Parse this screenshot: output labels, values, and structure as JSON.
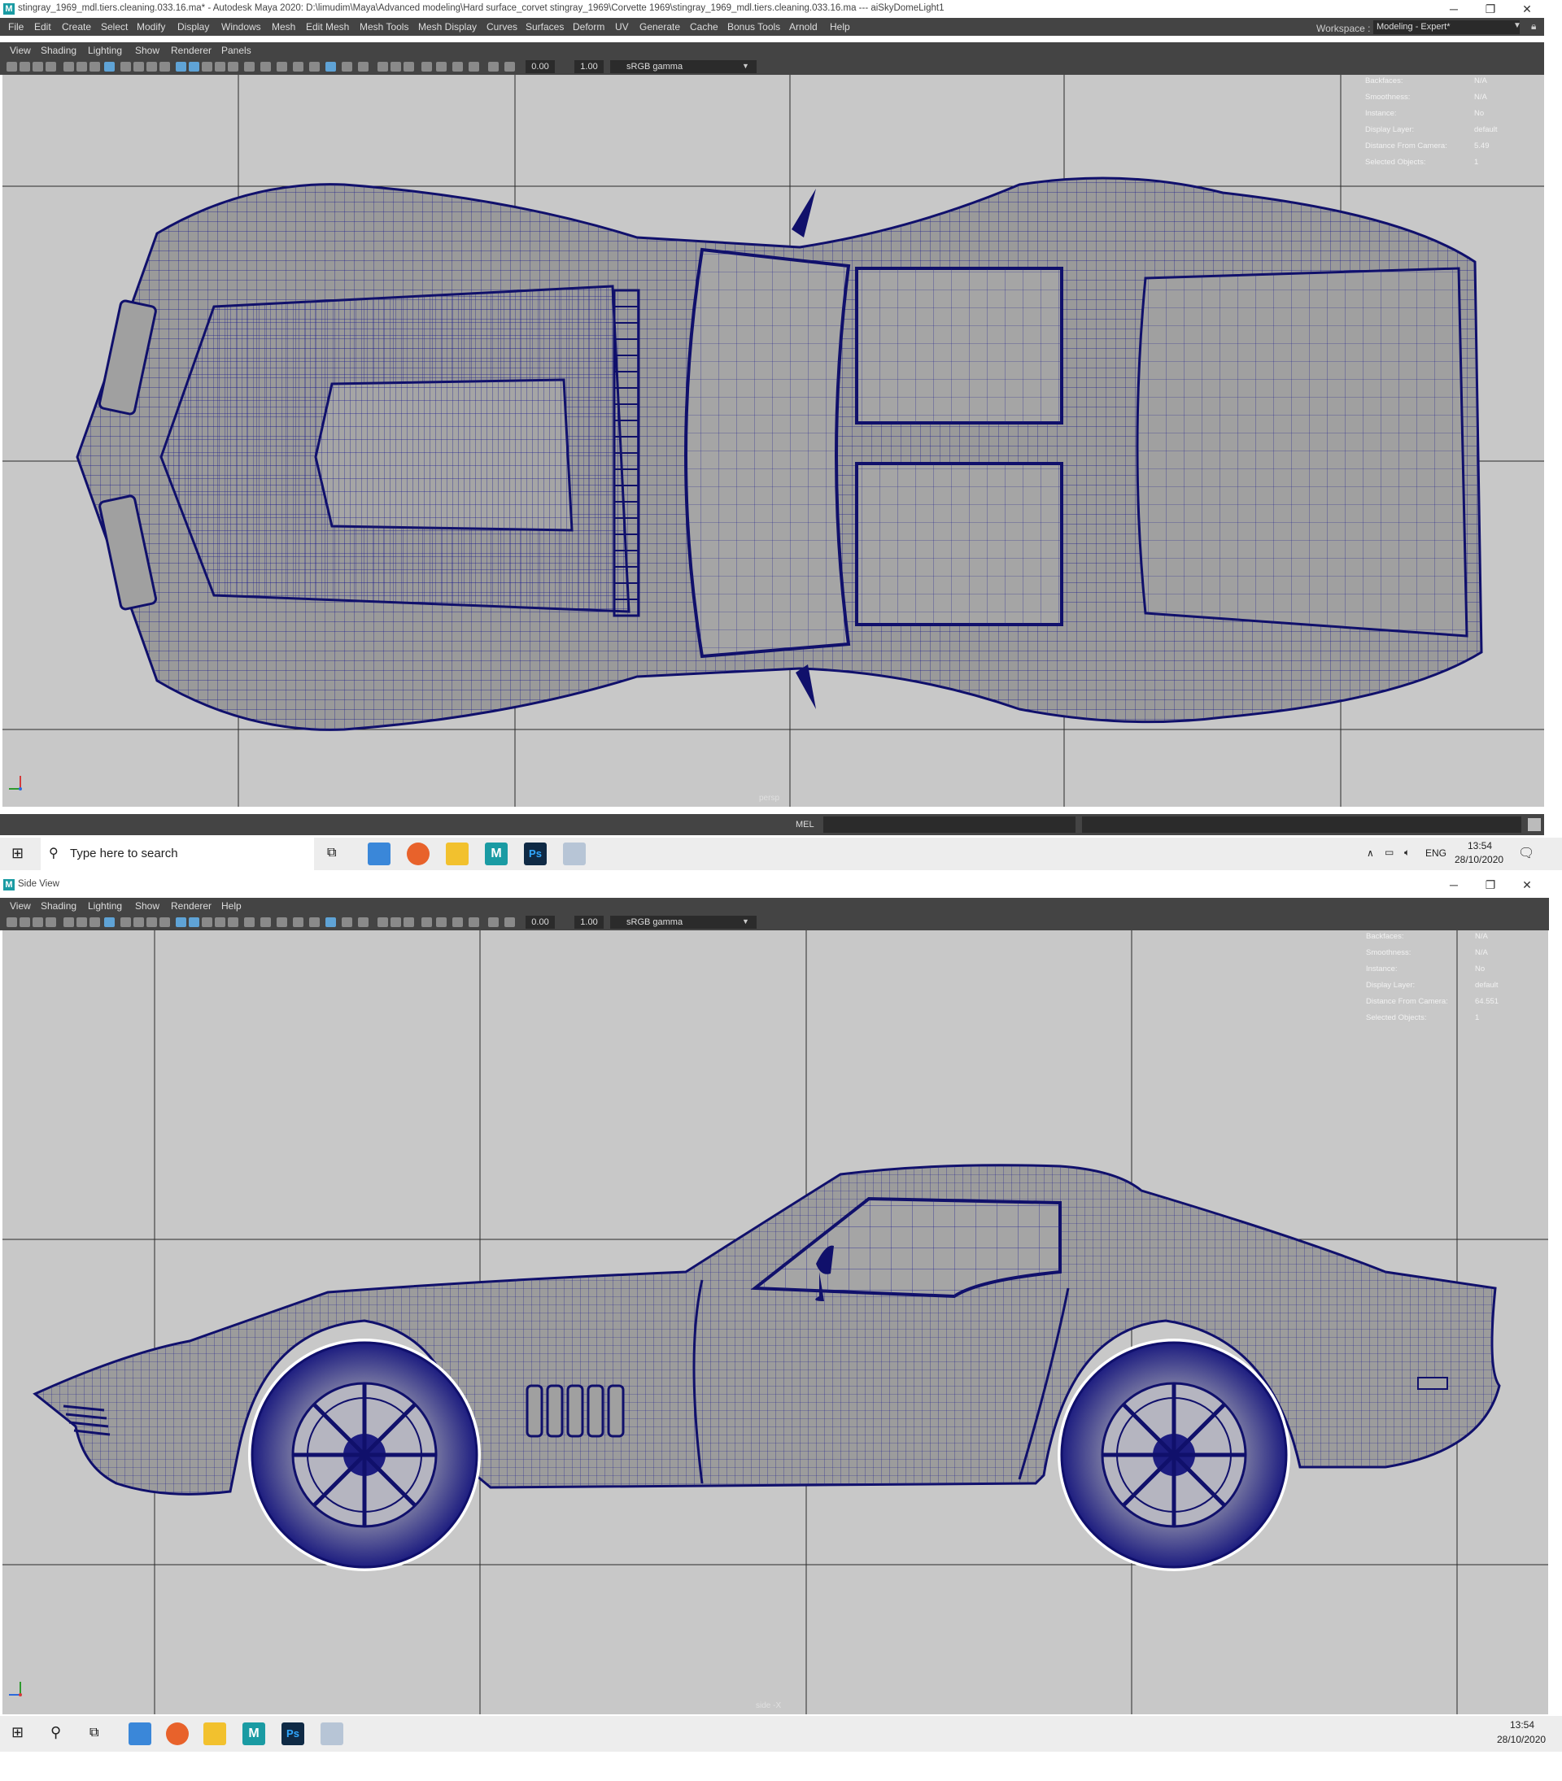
{
  "main_window": {
    "title": "stingray_1969_mdl.tiers.cleaning.033.16.ma* - Autodesk Maya 2020: D:\\limudim\\Maya\\Advanced modeling\\Hard surface_corvet stingray_1969\\Corvette 1969\\stingray_1969_mdl.tiers.cleaning.033.16.ma   ---   aiSkyDomeLight1",
    "menus": [
      "File",
      "Edit",
      "Create",
      "Select",
      "Modify",
      "Display",
      "Windows",
      "Mesh",
      "Edit Mesh",
      "Mesh Tools",
      "Mesh Display",
      "Curves",
      "Surfaces",
      "Deform",
      "UV",
      "Generate",
      "Cache",
      "Bonus Tools",
      "Arnold",
      "Help"
    ],
    "workspace_label": "Workspace :",
    "workspace_value": "Modeling - Expert*"
  },
  "window_controls": {
    "minimize": "─",
    "maximize": "❐",
    "close": "✕"
  },
  "panel_menus": [
    "View",
    "Shading",
    "Lighting",
    "Show",
    "Renderer",
    "Panels"
  ],
  "side_panel_menus": [
    "View",
    "Shading",
    "Lighting",
    "Show",
    "Renderer",
    "Help"
  ],
  "toolbar": {
    "exposure": "0.00",
    "gamma": "1.00",
    "color_space": "sRGB gamma"
  },
  "hud_labels": [
    "Backfaces:",
    "Smoothness:",
    "Instance:",
    "Display Layer:",
    "Distance From Camera:",
    "Selected Objects:"
  ],
  "top_view": {
    "hud_values": [
      "N/A",
      "N/A",
      "No",
      "default",
      "5.49",
      "1"
    ],
    "camera_label": "persp"
  },
  "command_line": {
    "label": "MEL"
  },
  "taskbar_1": {
    "search_placeholder": "Type here to search",
    "language": "ENG",
    "time": "13:54",
    "date": "28/10/2020"
  },
  "side_window": {
    "title": "Side View",
    "hud_values": [
      "N/A",
      "N/A",
      "No",
      "default",
      "64.551",
      "1"
    ],
    "camera_label": "side -X"
  },
  "taskbar_2": {
    "time": "13:54",
    "date": "28/10/2020"
  },
  "colors": {
    "wire": "#1a1a8c",
    "viewport_bg": "#c8c8c8",
    "maya_ui": "#444444",
    "highlight": "#5fa3d6"
  }
}
